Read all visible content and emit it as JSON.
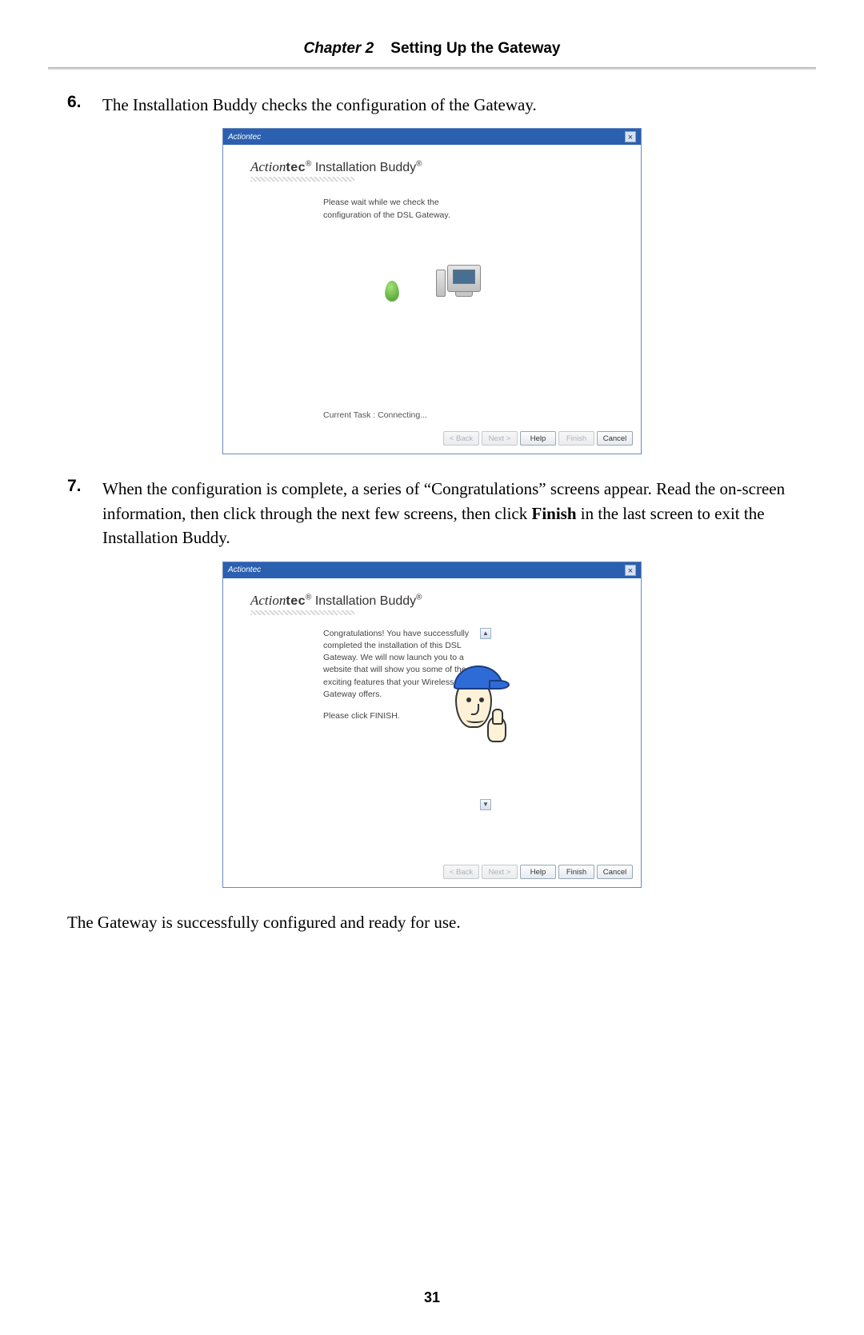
{
  "header": {
    "chapter_label": "Chapter 2",
    "title": "Setting Up the Gateway"
  },
  "steps": {
    "s6": {
      "num": "6.",
      "text": "The Installation Buddy checks the configuration of the Gateway."
    },
    "s7": {
      "num": "7.",
      "text_pre": "When the configuration is complete, a series of “Congratulations” screens appear. Read the on-screen information, then click through the next few screens, then click ",
      "text_bold": "Finish",
      "text_post": " in the last screen to exit the Installation Buddy."
    }
  },
  "window1": {
    "titlebar": "Actiontec",
    "brand_product": " Installation Buddy",
    "message": "Please wait while we check the configuration of the DSL Gateway.",
    "task": "Current Task : Connecting...",
    "buttons": {
      "back": "< Back",
      "next": "Next >",
      "help": "Help",
      "finish": "Finish",
      "cancel": "Cancel"
    }
  },
  "window2": {
    "titlebar": "Actiontec",
    "brand_product": " Installation Buddy",
    "message_p1": "Congratulations!  You have successfully completed the installation of this DSL Gateway. We will now launch you to a website that will show you some of the exciting features that your Wireless DSL Gateway offers.",
    "message_p2": "Please click FINISH.",
    "buttons": {
      "back": "< Back",
      "next": "Next >",
      "help": "Help",
      "finish": "Finish",
      "cancel": "Cancel"
    }
  },
  "closing": "The Gateway is successfully configured and ready for use.",
  "page_number": "31",
  "brand": {
    "action": "Action",
    "tec": "tec",
    "reg": "®"
  }
}
